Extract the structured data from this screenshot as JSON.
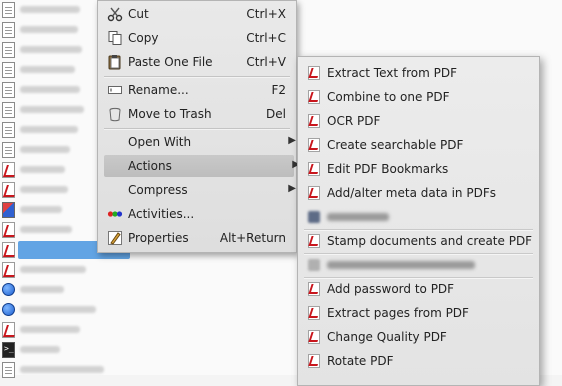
{
  "context_menu": {
    "items": [
      {
        "label": "Cut",
        "shortcut": "Ctrl+X",
        "icon": "scissors-icon"
      },
      {
        "label": "Copy",
        "shortcut": "Ctrl+C",
        "icon": "copy-icon"
      },
      {
        "label": "Paste One File",
        "shortcut": "Ctrl+V",
        "icon": "paste-icon"
      },
      {
        "label": "Rename...",
        "shortcut": "F2",
        "icon": "rename-icon"
      },
      {
        "label": "Move to Trash",
        "shortcut": "Del",
        "icon": "trash-icon"
      },
      {
        "label": "Open With"
      },
      {
        "label": "Actions"
      },
      {
        "label": "Compress"
      },
      {
        "label": "Activities...",
        "icon": "activities-icon"
      },
      {
        "label": "Properties",
        "shortcut": "Alt+Return",
        "icon": "properties-icon"
      }
    ]
  },
  "actions_submenu": {
    "items": [
      {
        "label": "Extract Text from PDF"
      },
      {
        "label": "Combine to one PDF"
      },
      {
        "label": "OCR PDF"
      },
      {
        "label": "Create searchable PDF"
      },
      {
        "label": "Edit PDF Bookmarks"
      },
      {
        "label": "Add/alter meta data in PDFs"
      },
      {
        "label": "Stamp documents and create PDF"
      },
      {
        "label": "Add password to PDF"
      },
      {
        "label": "Extract pages from PDF"
      },
      {
        "label": "Change Quality PDF"
      },
      {
        "label": "Rotate PDF"
      }
    ]
  }
}
